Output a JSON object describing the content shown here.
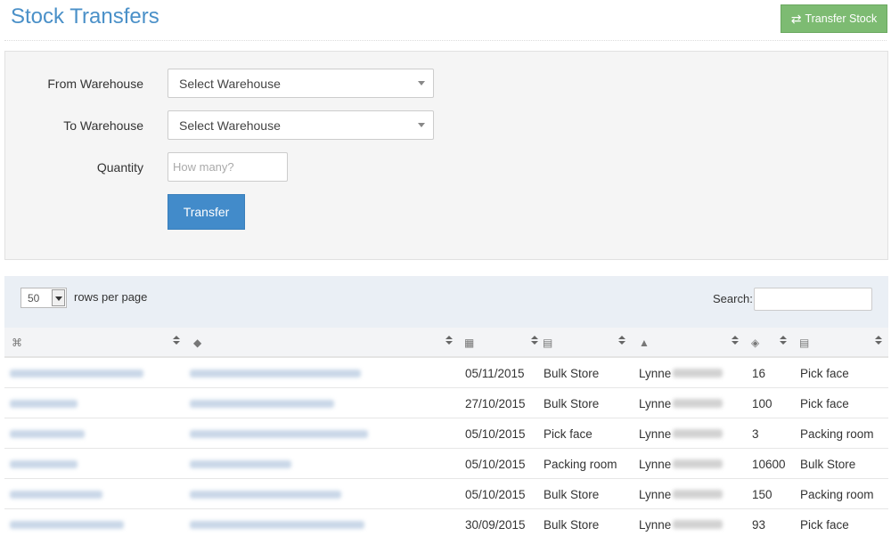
{
  "header": {
    "title": "Stock Transfers",
    "transfer_button": "Transfer Stock",
    "transfer_icon": "exchange-arrows-icon"
  },
  "form": {
    "from_label": "From Warehouse",
    "from_value": "Select Warehouse",
    "to_label": "To Warehouse",
    "to_value": "Select Warehouse",
    "qty_label": "Quantity",
    "qty_placeholder": "How many?",
    "submit_label": "Transfer"
  },
  "table_controls": {
    "rows_per_page": "50",
    "rows_label": "rows per page",
    "search_label": "Search:"
  },
  "columns": [
    {
      "icon": "tag-icon",
      "glyph": "⌘"
    },
    {
      "icon": "label-icon",
      "glyph": "◆"
    },
    {
      "icon": "calendar-icon",
      "glyph": "▦"
    },
    {
      "icon": "building-icon",
      "glyph": "▤"
    },
    {
      "icon": "user-icon",
      "glyph": "▲"
    },
    {
      "icon": "tags-icon",
      "glyph": "◈"
    },
    {
      "icon": "building-icon",
      "glyph": "▤"
    }
  ],
  "rows": [
    {
      "date": "05/11/2015",
      "from": "Bulk Store",
      "user": "Lynne",
      "qty": "16",
      "to": "Pick face"
    },
    {
      "date": "27/10/2015",
      "from": "Bulk Store",
      "user": "Lynne",
      "qty": "100",
      "to": "Pick face"
    },
    {
      "date": "05/10/2015",
      "from": "Pick face",
      "user": "Lynne",
      "qty": "3",
      "to": "Packing room"
    },
    {
      "date": "05/10/2015",
      "from": "Packing room",
      "user": "Lynne",
      "qty": "10600",
      "to": "Bulk Store"
    },
    {
      "date": "05/10/2015",
      "from": "Bulk Store",
      "user": "Lynne",
      "qty": "150",
      "to": "Packing room"
    },
    {
      "date": "30/09/2015",
      "from": "Bulk Store",
      "user": "Lynne",
      "qty": "93",
      "to": "Pick face"
    }
  ],
  "colors": {
    "title": "#4a90c8",
    "transfer_btn": "#7dbb72",
    "primary_btn": "#428bca"
  }
}
